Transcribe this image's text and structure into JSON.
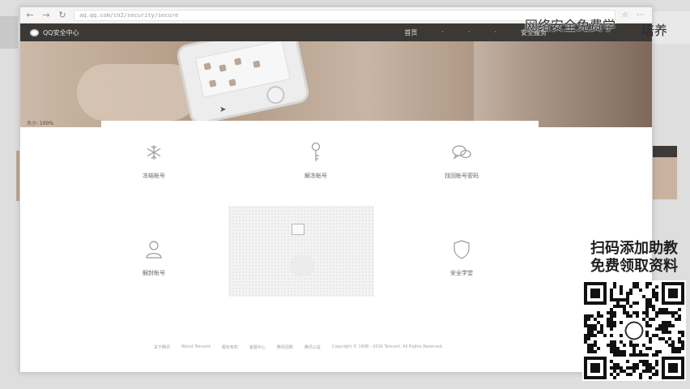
{
  "browser": {
    "url": "aq.qq.com/cn2/security/secure",
    "toolbar_left": [
      "←",
      "→",
      "↻"
    ],
    "toolbar_right": [
      "☆",
      "⋯"
    ]
  },
  "site": {
    "logo_text": "QQ安全中心",
    "nav_links": [
      "首页",
      "·",
      "·",
      "·",
      "安全服务"
    ]
  },
  "zoom_label": "大小: 100%",
  "tiles": [
    {
      "label": "冻结帐号",
      "icon": "snowflake-icon"
    },
    {
      "label": "解冻帐号",
      "icon": "key-icon"
    },
    {
      "label": "找回帐号密码",
      "icon": "chat-bubbles-icon"
    },
    {
      "label": "解封帐号",
      "icon": "user-icon"
    },
    {
      "label": "安全学堂",
      "icon": "shield-icon"
    }
  ],
  "footer_links": [
    "关于腾讯",
    "About Tencent",
    "服务条款",
    "客服中心",
    "腾讯招聘",
    "腾讯公益",
    "Copyright © 1998 - 2016 Tencent. All Rights Reserved."
  ],
  "watermark": {
    "top_text": "网络安全免费学",
    "top_suffix": "培养",
    "promo_line1": "扫码添加助教",
    "promo_line2": "免费领取资料"
  },
  "colors": {
    "nav_bg": "#3b3835",
    "hero_tone": "#b19984"
  }
}
